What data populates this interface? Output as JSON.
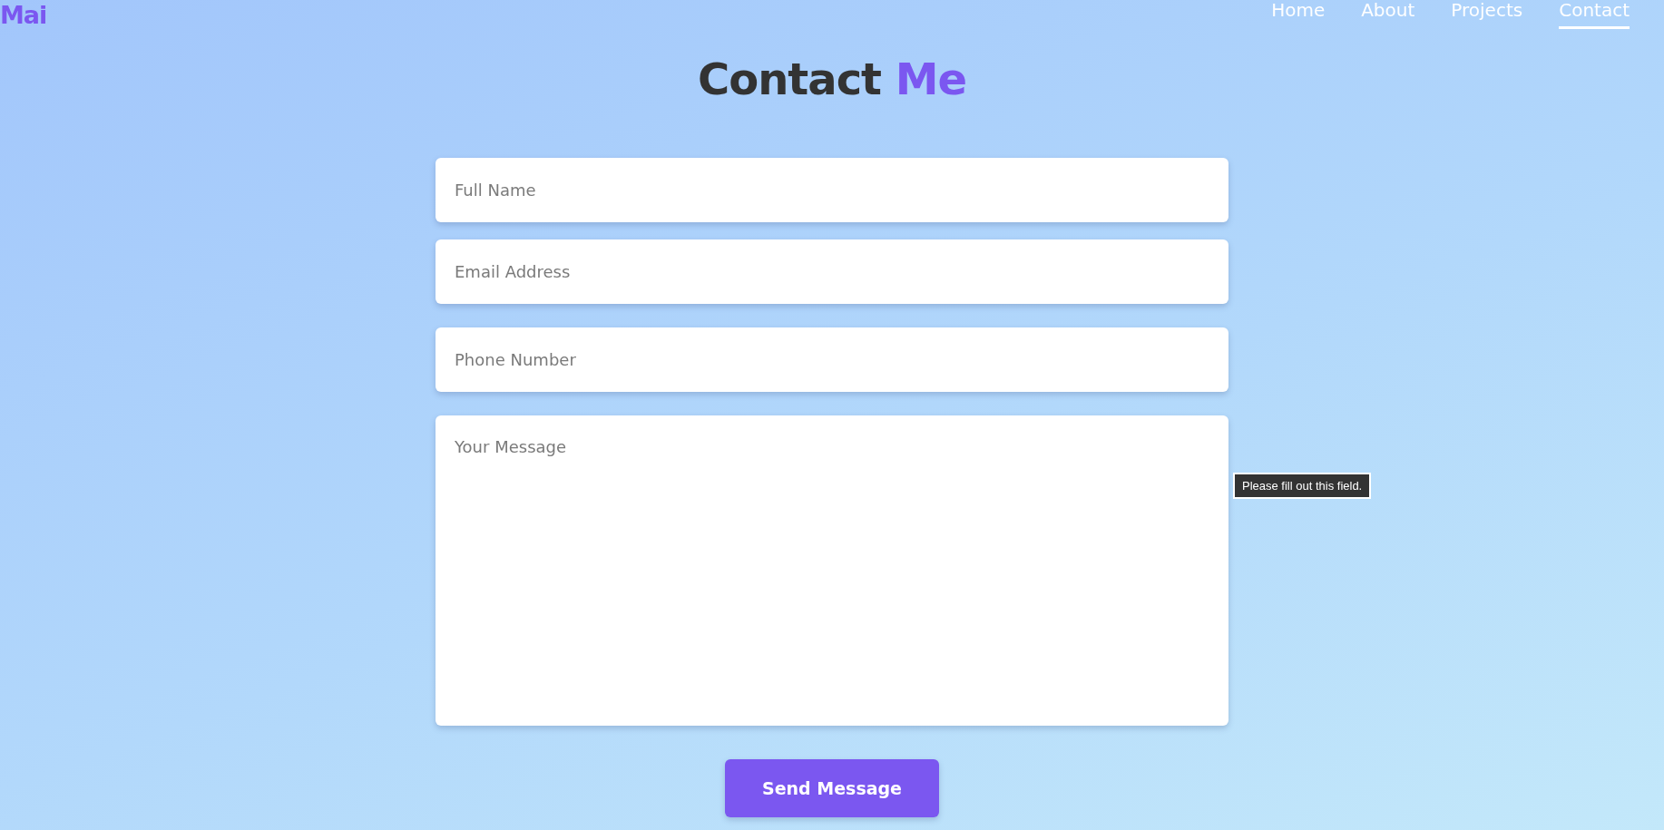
{
  "logo": "Mai",
  "nav": [
    {
      "label": "Home",
      "selected": false
    },
    {
      "label": "About",
      "selected": false
    },
    {
      "label": "Projects",
      "selected": false
    },
    {
      "label": "Contact",
      "selected": true
    }
  ],
  "title": {
    "text": "Contact",
    "highlight": "Me"
  },
  "form": {
    "fields": [
      {
        "kind": "input",
        "placeholder": "Full Name"
      },
      {
        "kind": "input",
        "placeholder": "Email Address"
      },
      {
        "kind": "input",
        "placeholder": "Phone Number"
      },
      {
        "kind": "textarea",
        "placeholder": "Your Message"
      }
    ],
    "tooltip": "Please fill out this field.",
    "submit": "Send Message"
  }
}
